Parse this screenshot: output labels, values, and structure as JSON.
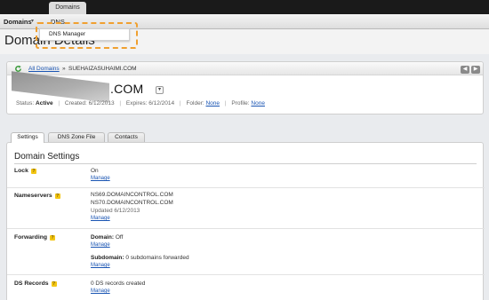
{
  "topbar": {
    "tab_label": "Domains"
  },
  "nav": {
    "domains_label": "Domains",
    "caret": "▾",
    "dns_label": "DNS"
  },
  "dropdown": {
    "item": "DNS Manager"
  },
  "header": {
    "title": "Domain Details"
  },
  "breadcrumb": {
    "all_label": "All Domains",
    "sep": "»",
    "current": "SUEHAIZASUHAIMI.COM"
  },
  "domain": {
    "name": ".COM",
    "status_label": "Status:",
    "status_value": "Active",
    "created_label": "Created:",
    "created_value": "6/12/2013",
    "expires_label": "Expires:",
    "expires_value": "6/12/2014",
    "folder_label": "Folder:",
    "folder_value": "None",
    "profile_label": "Profile:",
    "profile_value": "None"
  },
  "tabs": [
    "Settings",
    "DNS Zone File",
    "Contacts"
  ],
  "settings": {
    "title": "Domain Settings",
    "manage_label": "Manage",
    "lock": {
      "label": "Lock",
      "value": "On"
    },
    "nameservers": {
      "label": "Nameservers",
      "ns1": "NS69.DOMAINCONTROL.COM",
      "ns2": "NS70.DOMAINCONTROL.COM",
      "updated": "Updated 6/12/2013"
    },
    "forwarding": {
      "label": "Forwarding",
      "domain_key": "Domain:",
      "domain_value": "Off",
      "subdomain_key": "Subdomain:",
      "subdomain_value": "0 subdomains forwarded"
    },
    "ds_records": {
      "label": "DS Records",
      "value": "0 DS records created"
    }
  },
  "colors": {
    "accent_link": "#1a55b3",
    "highlight": "#f0a030",
    "help_icon": "#f3c613"
  }
}
